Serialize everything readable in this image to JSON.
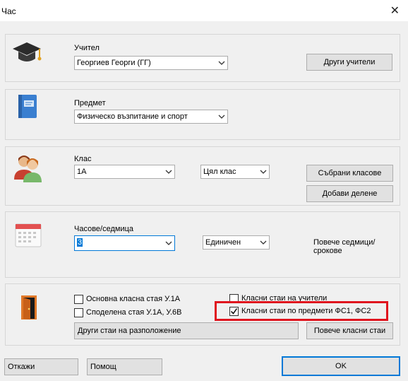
{
  "window": {
    "title": "Час",
    "close_glyph": "✕"
  },
  "teacher": {
    "label": "Учител",
    "value": "Георгиев Георги (ГГ)",
    "other_button": "Други учители",
    "icon": "graduation-cap-icon"
  },
  "subject": {
    "label": "Предмет",
    "value": "Физическо възпитание и спорт",
    "icon": "book-icon"
  },
  "class": {
    "label": "Клас",
    "value": "1А",
    "scope_value": "Цял клас",
    "combined_button": "Събрани класове",
    "add_division_button": "Добави делене",
    "icon": "users-icon"
  },
  "hours": {
    "label": "Часове/седмица",
    "value": "3",
    "mode_value": "Единичен",
    "more_weeks": "Повече седмици/срокове",
    "icon": "calendar-icon"
  },
  "rooms": {
    "icon": "door-icon",
    "main_room": {
      "label": "Основна класна стая У.1А",
      "checked": false
    },
    "shared_room": {
      "label": "Споделена стая У.1А, У.6В",
      "checked": false
    },
    "teacher_rooms": {
      "label": "Класни стаи на учители",
      "checked": false
    },
    "subject_rooms": {
      "label": "Класни стаи по предмети ФС1, ФС2",
      "checked": true
    },
    "other_button": "Други стаи на разположение",
    "more_button": "Повече класни стаи"
  },
  "footer": {
    "cancel": "Откажи",
    "help": "Помощ",
    "ok": "OK"
  },
  "colors": {
    "accent_border": "#0078d7",
    "highlight": "#e0141e"
  }
}
